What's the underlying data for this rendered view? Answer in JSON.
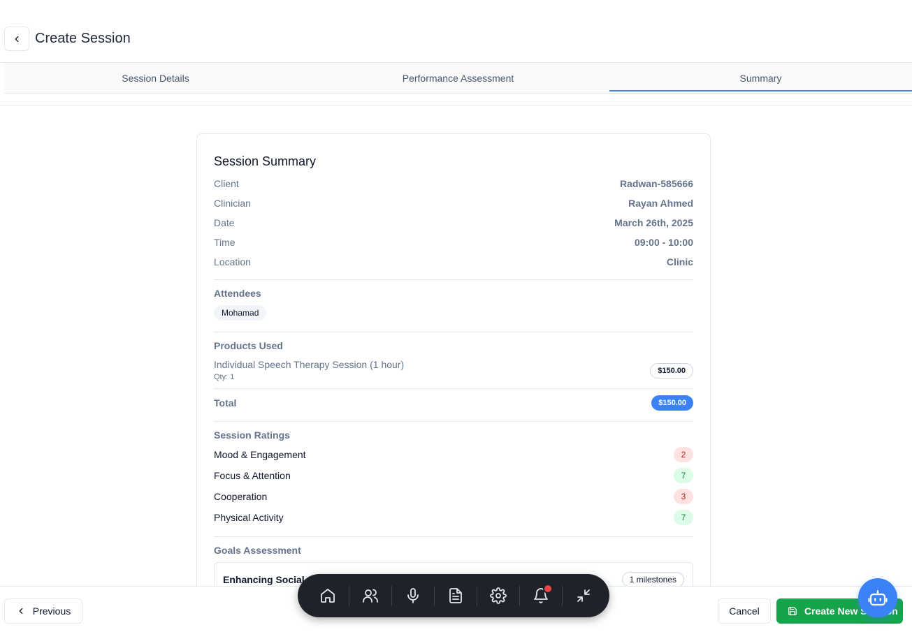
{
  "header": {
    "title": "Create Session"
  },
  "tabs": [
    {
      "label": "Session Details",
      "active": false
    },
    {
      "label": "Performance Assessment",
      "active": false
    },
    {
      "label": "Summary",
      "active": true
    }
  ],
  "summary": {
    "title": "Session Summary",
    "fields": [
      {
        "label": "Client",
        "value": "Radwan-585666"
      },
      {
        "label": "Clinician",
        "value": "Rayan Ahmed"
      },
      {
        "label": "Date",
        "value": "March 26th, 2025"
      },
      {
        "label": "Time",
        "value": "09:00 - 10:00"
      },
      {
        "label": "Location",
        "value": "Clinic"
      }
    ],
    "attendees_title": "Attendees",
    "attendees": [
      "Mohamad"
    ],
    "products_title": "Products Used",
    "products": [
      {
        "name": "Individual Speech Therapy Session (1 hour)",
        "qty": "Qty: 1",
        "price": "$150.00"
      }
    ],
    "total_label": "Total",
    "total_value": "$150.00",
    "ratings_title": "Session Ratings",
    "ratings": [
      {
        "label": "Mood & Engagement",
        "value": "2",
        "status": "low"
      },
      {
        "label": "Focus & Attention",
        "value": "7",
        "status": "high"
      },
      {
        "label": "Cooperation",
        "value": "3",
        "status": "low"
      },
      {
        "label": "Physical Activity",
        "value": "7",
        "status": "high"
      }
    ],
    "goals_title": "Goals Assessment",
    "goals": [
      {
        "title": "Enhancing Social C",
        "badge": "1 milestones"
      }
    ]
  },
  "footer": {
    "previous_label": "Previous",
    "cancel_label": "Cancel",
    "create_label": "Create New Session"
  },
  "dock": {
    "items": [
      "home-icon",
      "users-icon",
      "microphone-icon",
      "document-icon",
      "gear-icon",
      "bell-icon",
      "minimize-icon"
    ]
  },
  "colors": {
    "accent": "#3b82f6",
    "success": "#16a34a",
    "dock_bg": "#1f2329"
  }
}
